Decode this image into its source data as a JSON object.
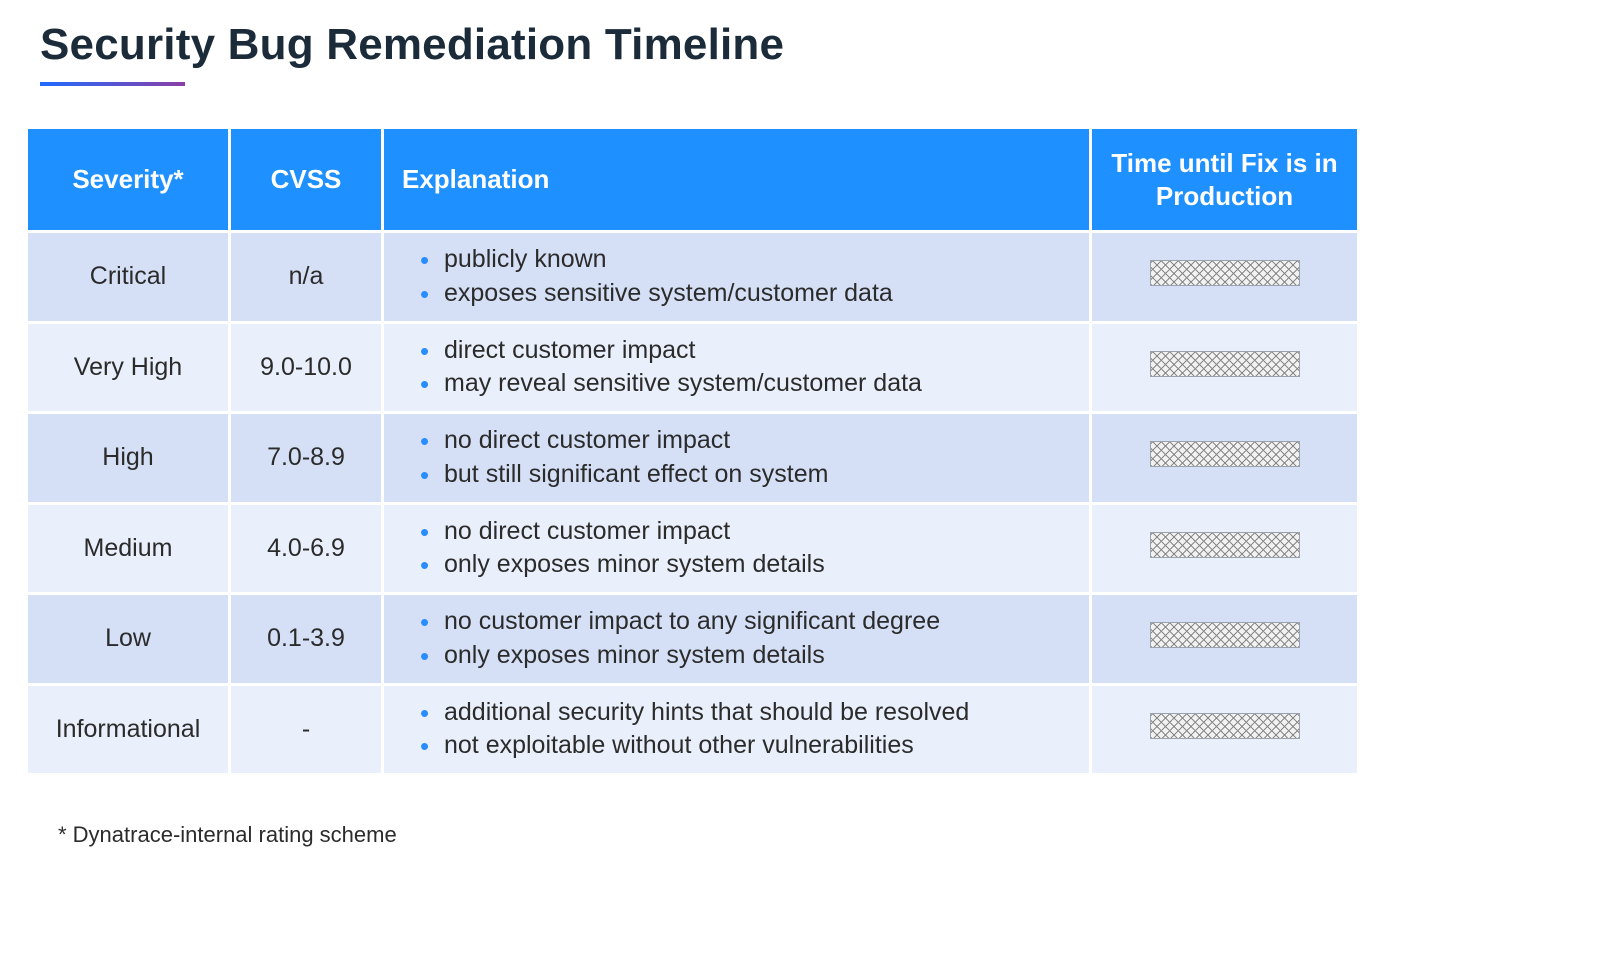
{
  "title": "Security Bug Remediation Timeline",
  "columns": {
    "severity": "Severity*",
    "cvss": "CVSS",
    "explanation": "Explanation",
    "time": "Time until Fix is in Production"
  },
  "rows": [
    {
      "severity": "Critical",
      "cvss": "n/a",
      "explanation": [
        "publicly known",
        "exposes sensitive system/customer data"
      ],
      "time_redacted": true
    },
    {
      "severity": "Very High",
      "cvss": "9.0-10.0",
      "explanation": [
        "direct customer impact",
        "may reveal sensitive system/customer data"
      ],
      "time_redacted": true
    },
    {
      "severity": "High",
      "cvss": "7.0-8.9",
      "explanation": [
        "no direct customer impact",
        "but still significant effect on system"
      ],
      "time_redacted": true
    },
    {
      "severity": "Medium",
      "cvss": "4.0-6.9",
      "explanation": [
        "no direct customer impact",
        "only exposes minor system details"
      ],
      "time_redacted": true
    },
    {
      "severity": "Low",
      "cvss": "0.1-3.9",
      "explanation": [
        "no customer impact to any significant degree",
        "only exposes minor system details"
      ],
      "time_redacted": true
    },
    {
      "severity": "Informational",
      "cvss": "-",
      "explanation": [
        "additional security hints that should be resolved",
        "not exploitable without other vulnerabilities"
      ],
      "time_redacted": true
    }
  ],
  "footnote": "* Dynatrace-internal rating scheme"
}
